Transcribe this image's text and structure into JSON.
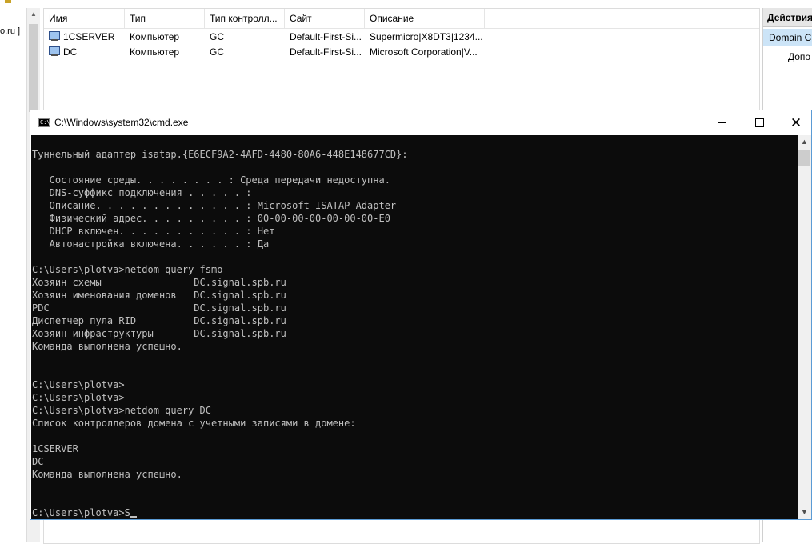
{
  "background": {
    "left_tree_text": "o.ru ]",
    "columns": [
      "Имя",
      "Тип",
      "Тип контролл...",
      "Сайт",
      "Описание"
    ],
    "rows": [
      {
        "name": "1CSERVER",
        "type": "Компьютер",
        "dc_type": "GC",
        "site": "Default-First-Si...",
        "description": "Supermicro|X8DT3|1234..."
      },
      {
        "name": "DC",
        "type": "Компьютер",
        "dc_type": "GC",
        "site": "Default-First-Si...",
        "description": "Microsoft Corporation|V..."
      }
    ],
    "actions": {
      "title": "Действия",
      "domain_item": "Domain C",
      "more_item": "Допо"
    }
  },
  "cmd": {
    "title": "C:\\Windows\\system32\\cmd.exe",
    "icon_glyph": "C:\\",
    "controls": {
      "minimize": "",
      "maximize": "",
      "close": "✕"
    },
    "lines": [
      "Туннельный адаптер isatap.{E6ECF9A2-4AFD-4480-80A6-448E148677CD}:",
      "",
      "   Состояние среды. . . . . . . . : Среда передачи недоступна.",
      "   DNS-суффикс подключения . . . . . :",
      "   Описание. . . . . . . . . . . . . : Microsoft ISATAP Adapter",
      "   Физический адрес. . . . . . . . . : 00-00-00-00-00-00-00-E0",
      "   DHCP включен. . . . . . . . . . . : Нет",
      "   Автонастройка включена. . . . . . : Да",
      "",
      "C:\\Users\\plotva>netdom query fsmo",
      "Хозяин схемы                DC.signal.spb.ru",
      "Хозяин именования доменов   DC.signal.spb.ru",
      "PDC                         DC.signal.spb.ru",
      "Диспетчер пула RID          DC.signal.spb.ru",
      "Хозяин инфраструктуры       DC.signal.spb.ru",
      "Команда выполнена успешно.",
      "",
      "",
      "C:\\Users\\plotva>",
      "C:\\Users\\plotva>",
      "C:\\Users\\plotva>netdom query DC",
      "Список контроллеров домена с учетными записями в домене:",
      "",
      "1CSERVER",
      "DC",
      "Команда выполнена успешно.",
      "",
      ""
    ],
    "prompt": "C:\\Users\\plotva>S"
  }
}
